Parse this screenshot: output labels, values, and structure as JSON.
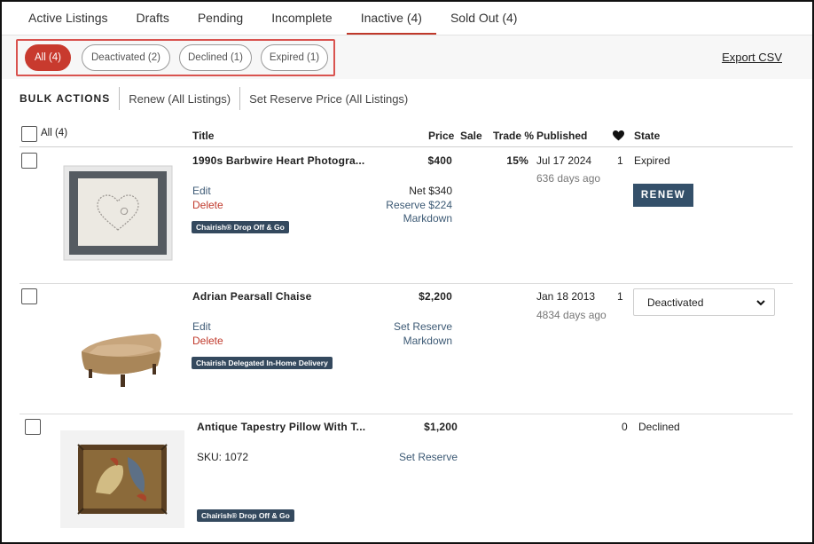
{
  "tabs": [
    {
      "label": "Active Listings"
    },
    {
      "label": "Drafts"
    },
    {
      "label": "Pending"
    },
    {
      "label": "Incomplete"
    },
    {
      "label": "Inactive (4)",
      "active": true
    },
    {
      "label": "Sold Out (4)"
    }
  ],
  "filters": {
    "pills": [
      {
        "label": "All (4)",
        "active": true
      },
      {
        "label": "Deactivated (2)"
      },
      {
        "label": "Declined (1)"
      },
      {
        "label": "Expired (1)"
      }
    ],
    "export_label": "Export CSV"
  },
  "bulk": {
    "title": "BULK ACTIONS",
    "renew": "Renew (All Listings)",
    "reserve": "Set Reserve Price (All Listings)"
  },
  "table": {
    "select_all": "All (4)",
    "columns": {
      "title": "Title",
      "price": "Price",
      "sale": "Sale",
      "trade": "Trade %",
      "published": "Published",
      "state": "State"
    },
    "rows": [
      {
        "title": "1990s Barbwire Heart Photogra...",
        "edit": "Edit",
        "delete": "Delete",
        "badge": "Chairish® Drop Off & Go",
        "price": "$400",
        "net": "Net $340",
        "reserve": "Reserve $224",
        "markdown": "Markdown",
        "trade": "15%",
        "published": "Jul 17 2024",
        "age": "636 days ago",
        "likes": "1",
        "state": "Expired",
        "action": "RENEW"
      },
      {
        "title": "Adrian Pearsall Chaise",
        "edit": "Edit",
        "delete": "Delete",
        "badge": "Chairish Delegated In-Home Delivery",
        "price": "$2,200",
        "reserve": "Set Reserve",
        "markdown": "Markdown",
        "published": "Jan 18 2013",
        "age": "4834 days ago",
        "likes": "1",
        "state": "Deactivated"
      },
      {
        "title": "Antique Tapestry Pillow With T...",
        "sku": "SKU: 1072",
        "badge": "Chairish® Drop Off & Go",
        "price": "$1,200",
        "reserve": "Set Reserve",
        "likes": "0",
        "state": "Declined"
      }
    ]
  },
  "colors": {
    "accent": "#c83a2e",
    "link": "#3d5a75",
    "badge": "#34495e",
    "highlight_box": "#d9534f"
  }
}
